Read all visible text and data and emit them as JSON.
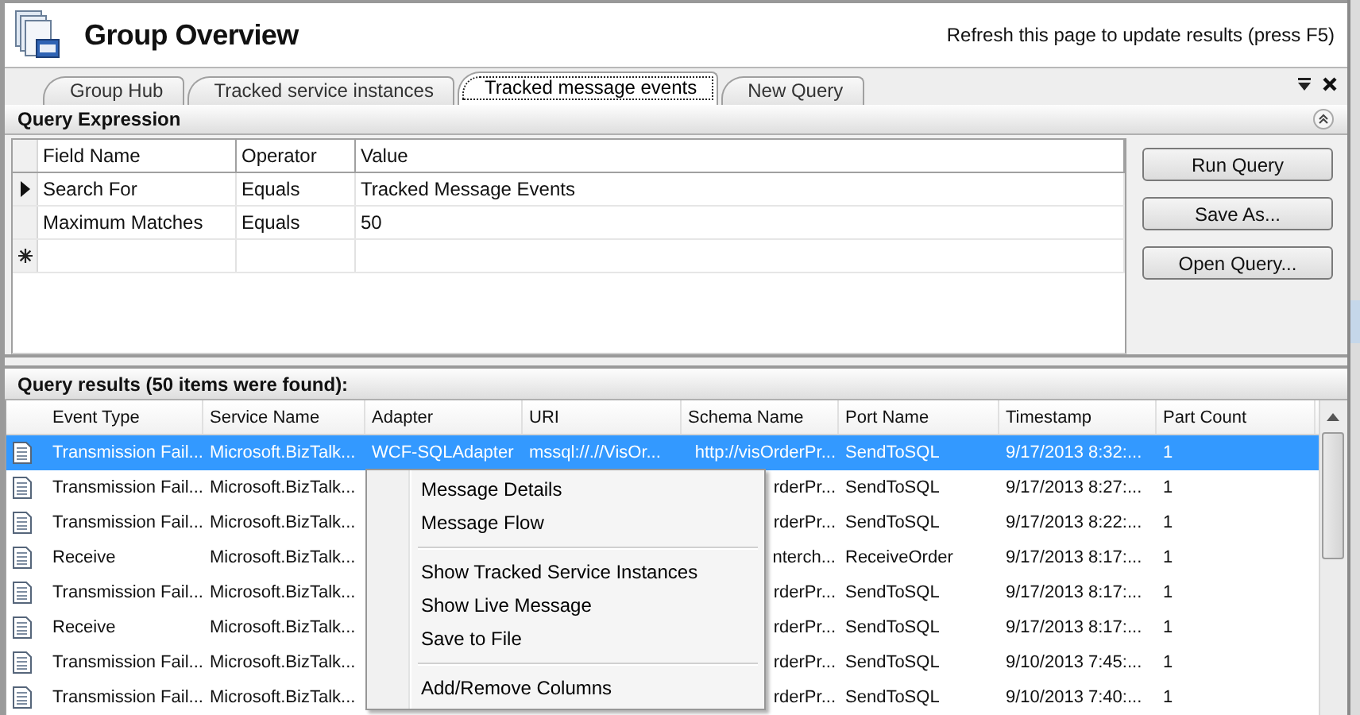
{
  "window": {
    "title": "Group Overview",
    "hint": "Refresh this page to update results (press F5)"
  },
  "tabs": [
    {
      "label": "Group Hub",
      "selected": false
    },
    {
      "label": "Tracked service instances",
      "selected": false
    },
    {
      "label": "Tracked message events",
      "selected": true
    },
    {
      "label": "New Query",
      "selected": false
    }
  ],
  "query_expression": {
    "title": "Query Expression",
    "columns": [
      "Field Name",
      "Operator",
      "Value"
    ],
    "rows": [
      {
        "field": "Search For",
        "operator": "Equals",
        "value": "Tracked Message Events",
        "current": true
      },
      {
        "field": "Maximum Matches",
        "operator": "Equals",
        "value": "50",
        "current": false
      }
    ]
  },
  "buttons": [
    "Run Query",
    "Save As...",
    "Open Query..."
  ],
  "results": {
    "title": "Query results (50 items were found):",
    "columns": [
      "Event Type",
      "Service Name",
      "Adapter",
      "URI",
      "Schema Name",
      "Port Name",
      "Timestamp",
      "Part Count"
    ],
    "rows": [
      {
        "selected": true,
        "event_type": "Transmission Fail...",
        "service_name": "Microsoft.BizTalk...",
        "adapter": "WCF-SQLAdapter",
        "uri": "mssql://.//VisOr...",
        "schema_name": "http://visOrderPr...",
        "port_name": "SendToSQL",
        "timestamp": "9/17/2013 8:32:...",
        "part_count": "1"
      },
      {
        "selected": false,
        "event_type": "Transmission Fail...",
        "service_name": "Microsoft.BizTalk...",
        "schema_name": "rderPr...",
        "port_name": "SendToSQL",
        "timestamp": "9/17/2013 8:27:...",
        "part_count": "1"
      },
      {
        "selected": false,
        "event_type": "Transmission Fail...",
        "service_name": "Microsoft.BizTalk...",
        "schema_name": "rderPr...",
        "port_name": "SendToSQL",
        "timestamp": "9/17/2013 8:22:...",
        "part_count": "1"
      },
      {
        "selected": false,
        "event_type": "Receive",
        "service_name": "Microsoft.BizTalk...",
        "schema_name": "nterch...",
        "port_name": "ReceiveOrder",
        "timestamp": "9/17/2013 8:17:...",
        "part_count": "1"
      },
      {
        "selected": false,
        "event_type": "Transmission Fail...",
        "service_name": "Microsoft.BizTalk...",
        "schema_name": "rderPr...",
        "port_name": "SendToSQL",
        "timestamp": "9/17/2013 8:17:...",
        "part_count": "1"
      },
      {
        "selected": false,
        "event_type": "Receive",
        "service_name": "Microsoft.BizTalk...",
        "schema_name": "rderPr...",
        "port_name": "SendToSQL",
        "timestamp": "9/17/2013 8:17:...",
        "part_count": "1"
      },
      {
        "selected": false,
        "event_type": "Transmission Fail...",
        "service_name": "Microsoft.BizTalk...",
        "schema_name": "rderPr...",
        "port_name": "SendToSQL",
        "timestamp": "9/10/2013 7:45:...",
        "part_count": "1"
      },
      {
        "selected": false,
        "event_type": "Transmission Fail...",
        "service_name": "Microsoft.BizTalk...",
        "schema_name": "rderPr...",
        "port_name": "SendToSQL",
        "timestamp": "9/10/2013 7:40:...",
        "part_count": "1"
      }
    ]
  },
  "context_menu": {
    "items": [
      {
        "kind": "item",
        "label": "Message Details"
      },
      {
        "kind": "item",
        "label": "Message Flow"
      },
      {
        "kind": "separator"
      },
      {
        "kind": "item",
        "label": "Show Tracked Service Instances"
      },
      {
        "kind": "item",
        "label": "Show Live Message"
      },
      {
        "kind": "item",
        "label": "Save to File"
      },
      {
        "kind": "separator"
      },
      {
        "kind": "item",
        "label": "Add/Remove Columns"
      }
    ]
  }
}
